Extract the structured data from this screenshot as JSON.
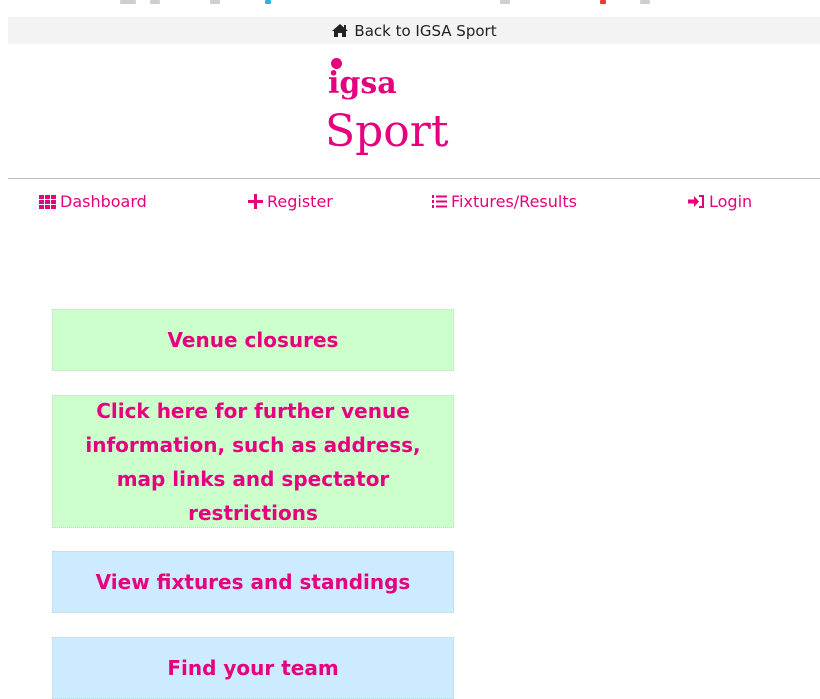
{
  "back_link": {
    "icon": "home-icon",
    "label": "Back to IGSA Sport"
  },
  "logo": {
    "small_text": "igsa",
    "big_text": "Sport",
    "brand_color": "#e6007e"
  },
  "nav": {
    "items": [
      {
        "icon": "grid-icon",
        "label": "Dashboard"
      },
      {
        "icon": "plus-icon",
        "label": "Register"
      },
      {
        "icon": "ordered-list-icon",
        "label": "Fixtures/Results"
      },
      {
        "icon": "sign-in-icon",
        "label": "Login"
      }
    ]
  },
  "panels": [
    {
      "label": "Venue closures",
      "color": "#ccffcc"
    },
    {
      "label": "Click here for further venue information, such as address, map links and spectator restrictions",
      "color": "#ccffcc"
    },
    {
      "label": "View fixtures and standings",
      "color": "#ccebff"
    },
    {
      "label": "Find your team",
      "color": "#ccebff"
    }
  ]
}
